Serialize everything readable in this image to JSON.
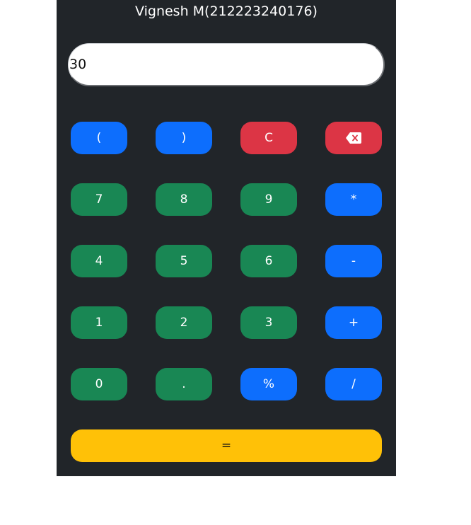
{
  "header": {
    "title": "Vignesh M(212223240176)"
  },
  "display": {
    "value": "30"
  },
  "keypad": {
    "row1": [
      "(",
      ")",
      "C"
    ],
    "backspace_icon": "backspace-icon",
    "row2": [
      "7",
      "8",
      "9",
      "*"
    ],
    "row3": [
      "4",
      "5",
      "6",
      "-"
    ],
    "row4": [
      "1",
      "2",
      "3",
      "+"
    ],
    "row5": [
      "0",
      ".",
      "%",
      "/"
    ],
    "equals": "="
  },
  "colors": {
    "background": "#212529",
    "operator": "#0d6efd",
    "number": "#198754",
    "clear": "#dc3545",
    "equals": "#ffc107"
  }
}
